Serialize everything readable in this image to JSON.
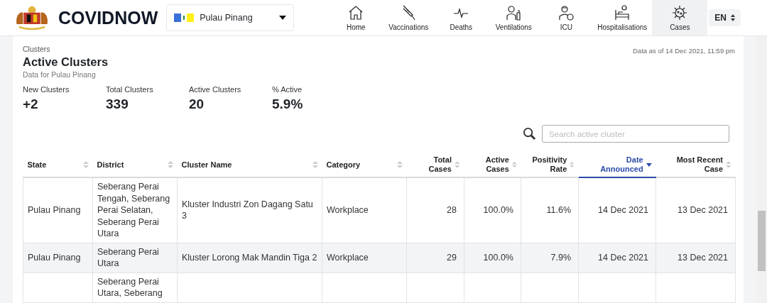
{
  "header": {
    "brand": "COVIDNOW",
    "state_select": {
      "value": "Pulau Pinang"
    },
    "nav": [
      {
        "label": "Home",
        "selected": false
      },
      {
        "label": "Vaccinations",
        "selected": false
      },
      {
        "label": "Deaths",
        "selected": false
      },
      {
        "label": "Ventilations",
        "selected": false
      },
      {
        "label": "ICU",
        "selected": false
      },
      {
        "label": "Hospitalisations",
        "selected": false
      },
      {
        "label": "Cases",
        "selected": true
      }
    ],
    "language": "EN"
  },
  "section": {
    "eyebrow": "Clusters",
    "title": "Active Clusters",
    "subtitle": "Data for Pulau Pinang",
    "updated": "Data as of 14 Dec 2021, 11:59 pm"
  },
  "stats": [
    {
      "label": "New Clusters",
      "value": "+2"
    },
    {
      "label": "Total Clusters",
      "value": "339"
    },
    {
      "label": "Active Clusters",
      "value": "20"
    },
    {
      "label": "% Active",
      "value": "5.9%"
    }
  ],
  "search": {
    "placeholder": "Search active cluster"
  },
  "table": {
    "columns": [
      {
        "label": "State",
        "sorted": false
      },
      {
        "label": "District",
        "sorted": false
      },
      {
        "label": "Cluster Name",
        "sorted": false
      },
      {
        "label": "Category",
        "sorted": false
      },
      {
        "label": "Total Cases",
        "sorted": false
      },
      {
        "label": "Active Cases",
        "sorted": false
      },
      {
        "label": "Positivity Rate",
        "sorted": false
      },
      {
        "label": "Date Announced",
        "sorted": true
      },
      {
        "label": "Most Recent Case",
        "sorted": false
      }
    ],
    "rows": [
      {
        "state": "Pulau Pinang",
        "district": "Seberang Perai Tengah, Seberang Perai Selatan, Seberang Perai Utara",
        "cluster_name": "Kluster Industri Zon Dagang Satu 3",
        "category": "Workplace",
        "total_cases": "28",
        "active_cases": "100.0%",
        "positivity_rate": "11.6%",
        "date_announced": "14 Dec 2021",
        "most_recent_case": "13 Dec 2021"
      },
      {
        "state": "Pulau Pinang",
        "district": "Seberang Perai Utara",
        "cluster_name": "Kluster Lorong Mak Mandin Tiga 2",
        "category": "Workplace",
        "total_cases": "29",
        "active_cases": "100.0%",
        "positivity_rate": "7.9%",
        "date_announced": "14 Dec 2021",
        "most_recent_case": "13 Dec 2021"
      },
      {
        "district": "Seberang Perai Utara, Seberang"
      }
    ]
  }
}
